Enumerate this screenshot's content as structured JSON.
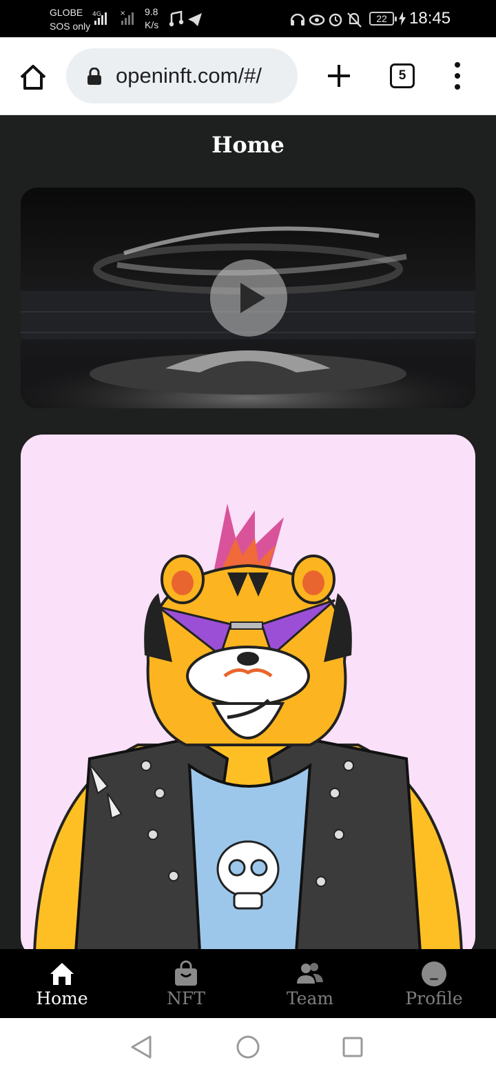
{
  "status_bar": {
    "carrier_line1": "GLOBE",
    "carrier_line2": "SOS only",
    "network": "4G",
    "speed_value": "9.8",
    "speed_unit": "K/s",
    "battery": "22",
    "time": "18:45"
  },
  "browser": {
    "url": "openinft.com/#/",
    "tab_count": "5"
  },
  "page": {
    "title": "Home"
  },
  "bottom_nav": {
    "items": [
      {
        "label": "Home",
        "icon": "home-icon",
        "active": true
      },
      {
        "label": "NFT",
        "icon": "shopping-bag-icon",
        "active": false
      },
      {
        "label": "Team",
        "icon": "team-icon",
        "active": false
      },
      {
        "label": "Profile",
        "icon": "profile-icon",
        "active": false
      }
    ]
  },
  "colors": {
    "page_background": "#1e1f1f",
    "nft_card_background": "#fae0f8",
    "nav_active": "#ffffff",
    "nav_inactive": "#7f7f7f"
  }
}
